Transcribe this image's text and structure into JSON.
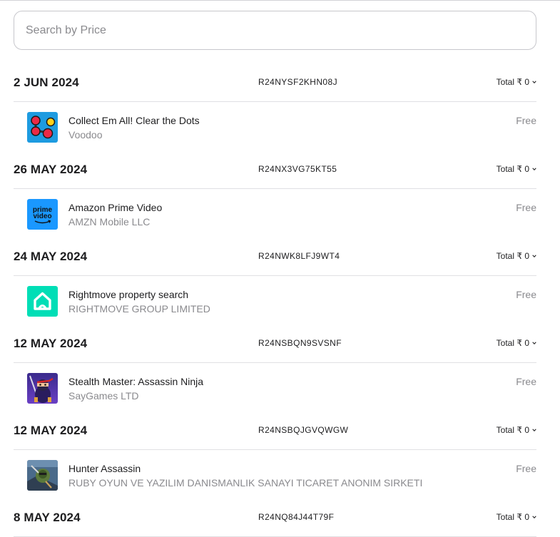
{
  "search": {
    "placeholder": "Search by Price"
  },
  "groups": [
    {
      "date": "2 JUN 2024",
      "order_id": "R24NYSF2KHN08J",
      "total": "Total ₹ 0",
      "item": {
        "name": "Collect Em All! Clear the Dots",
        "developer": "Voodoo",
        "price": "Free",
        "icon": "dots-game-icon"
      }
    },
    {
      "date": "26 MAY 2024",
      "order_id": "R24NX3VG75KT55",
      "total": "Total ₹ 0",
      "item": {
        "name": "Amazon Prime Video",
        "developer": "AMZN Mobile LLC",
        "price": "Free",
        "icon": "prime-video-icon",
        "icon_text_1": "prime",
        "icon_text_2": "video"
      }
    },
    {
      "date": "24 MAY 2024",
      "order_id": "R24NWK8LFJ9WT4",
      "total": "Total ₹ 0",
      "item": {
        "name": "Rightmove property search",
        "developer": "RIGHTMOVE GROUP LIMITED",
        "price": "Free",
        "icon": "rightmove-house-icon"
      }
    },
    {
      "date": "12 MAY 2024",
      "order_id": "R24NSBQN9SVSNF",
      "total": "Total ₹ 0",
      "item": {
        "name": "Stealth Master: Assassin Ninja",
        "developer": "SayGames LTD",
        "price": "Free",
        "icon": "ninja-game-icon"
      }
    },
    {
      "date": "12 MAY 2024",
      "order_id": "R24NSBQJGVQWGW",
      "total": "Total ₹ 0",
      "item": {
        "name": "Hunter Assassin",
        "developer": "RUBY OYUN VE YAZILIM DANISMANLIK SANAYI TICARET ANONIM SIRKETI",
        "price": "Free",
        "icon": "hunter-game-icon"
      }
    },
    {
      "date": "8 MAY 2024",
      "order_id": "R24NQ84J44T79F",
      "total": "Total ₹ 0"
    }
  ],
  "colors": {
    "text": "#1d1d1f",
    "secondary": "#8a8a8e",
    "divider": "#e0e0e3",
    "prime_blue": "#1a98ff",
    "rightmove_teal": "#00deb6",
    "dots_blue": "#1e9be0"
  }
}
